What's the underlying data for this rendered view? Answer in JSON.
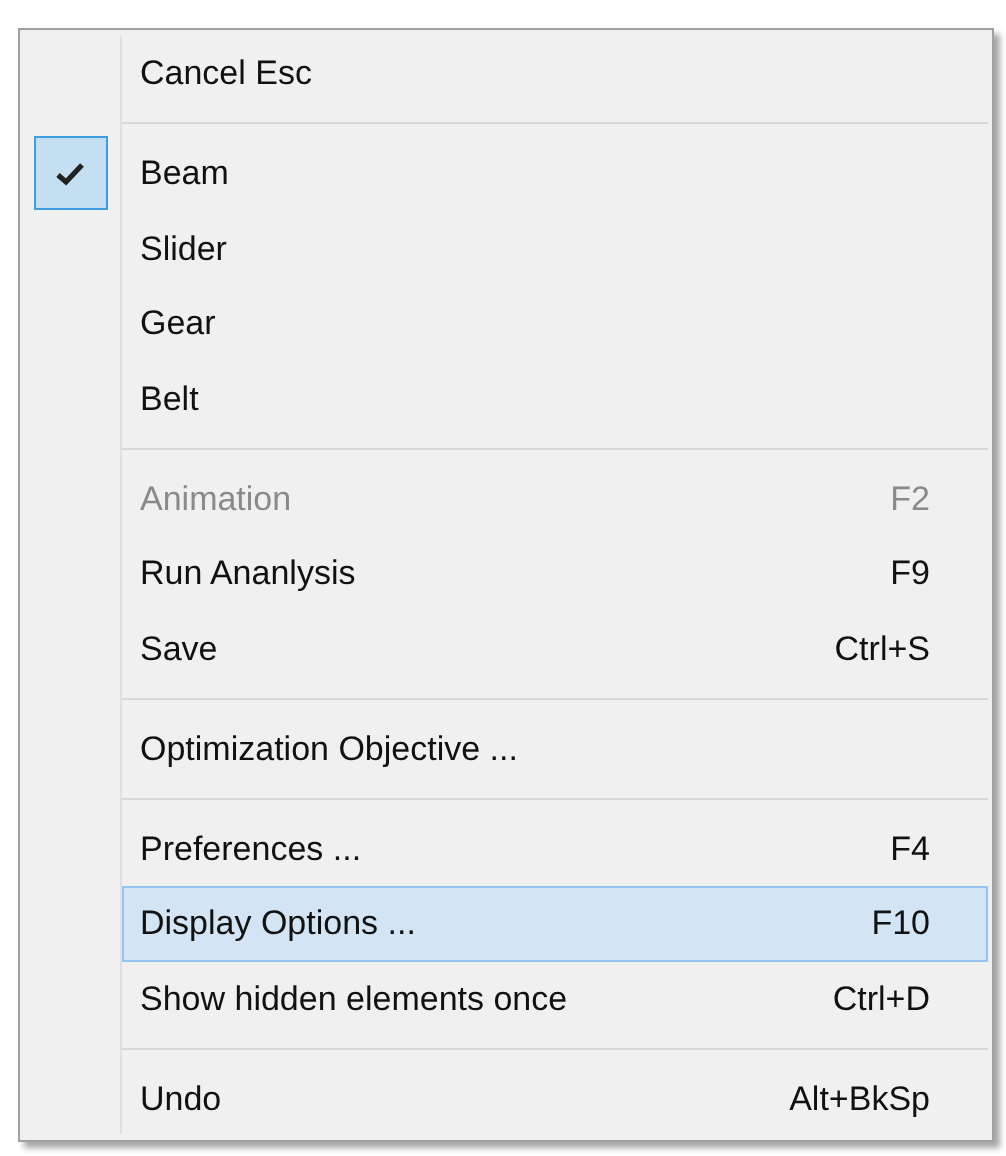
{
  "menu": {
    "sections": [
      [
        {
          "label": "Cancel Esc",
          "checked": false,
          "disabled": false,
          "selected": false
        }
      ],
      [
        {
          "label": "Beam",
          "checked": true,
          "disabled": false,
          "selected": false
        },
        {
          "label": "Slider",
          "checked": false,
          "disabled": false,
          "selected": false
        },
        {
          "label": "Gear",
          "checked": false,
          "disabled": false,
          "selected": false
        },
        {
          "label": "Belt",
          "checked": false,
          "disabled": false,
          "selected": false
        }
      ],
      [
        {
          "label": "Animation",
          "shortcut": "F2",
          "checked": false,
          "disabled": true,
          "selected": false
        },
        {
          "label": "Run Ananlysis",
          "shortcut": "F9",
          "checked": false,
          "disabled": false,
          "selected": false
        },
        {
          "label": "Save",
          "shortcut": "Ctrl+S",
          "checked": false,
          "disabled": false,
          "selected": false
        }
      ],
      [
        {
          "label": "Optimization Objective ...",
          "checked": false,
          "disabled": false,
          "selected": false
        }
      ],
      [
        {
          "label": "Preferences ...",
          "shortcut": "F4",
          "checked": false,
          "disabled": false,
          "selected": false
        },
        {
          "label": "Display Options ...",
          "shortcut": "F10",
          "checked": false,
          "disabled": false,
          "selected": true
        },
        {
          "label": "Show hidden elements once",
          "shortcut": "Ctrl+D",
          "checked": false,
          "disabled": false,
          "selected": false
        }
      ],
      [
        {
          "label": "Undo",
          "shortcut": "Alt+BkSp",
          "checked": false,
          "disabled": false,
          "selected": false
        }
      ]
    ]
  }
}
